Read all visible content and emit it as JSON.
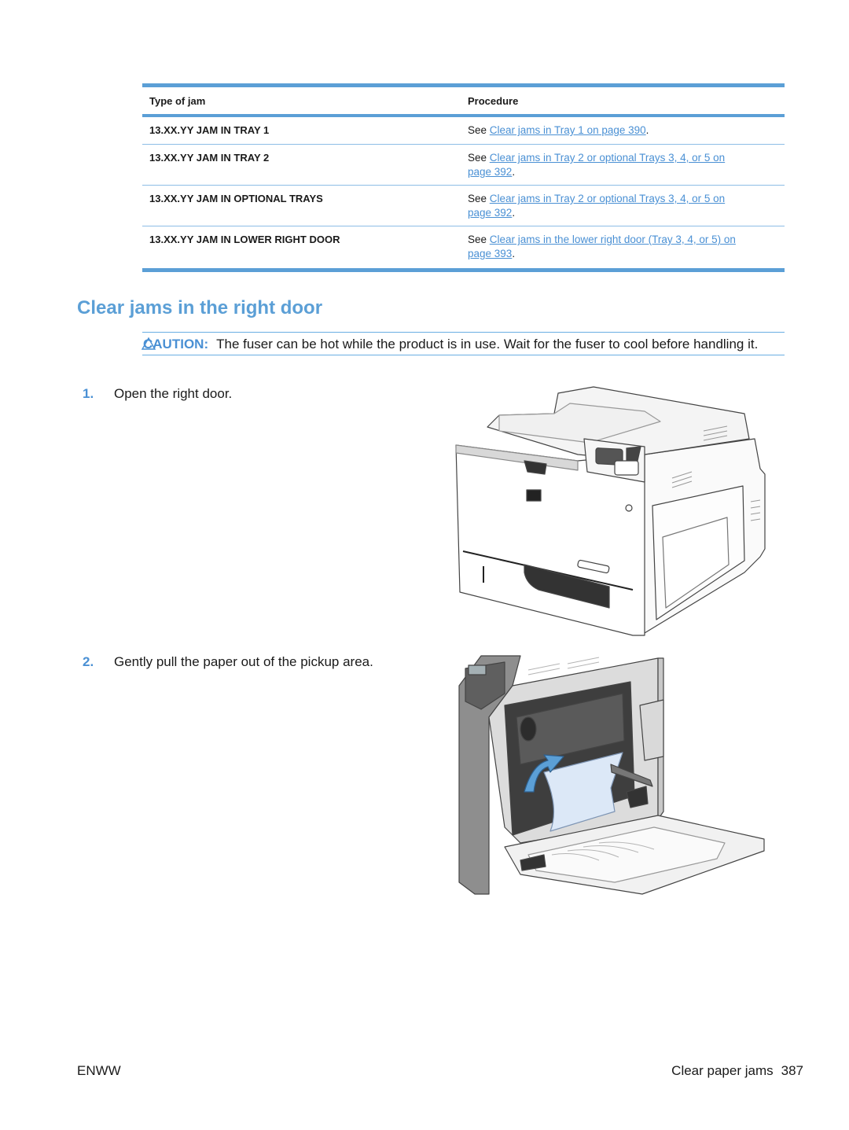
{
  "table": {
    "headers": {
      "type": "Type of jam",
      "procedure": "Procedure"
    },
    "rows": [
      {
        "type": "13.XX.YY JAM IN TRAY 1",
        "see": "See ",
        "link": "Clear jams in Tray 1 on page 390",
        "after": "."
      },
      {
        "type": "13.XX.YY JAM IN TRAY 2",
        "see": "See ",
        "link": "Clear jams in Tray 2 or optional Trays 3, 4, or 5 on page 392",
        "after": "."
      },
      {
        "type": "13.XX.YY JAM IN OPTIONAL TRAYS",
        "see": "See ",
        "link": "Clear jams in Tray 2 or optional Trays 3, 4, or 5 on page 392",
        "after": "."
      },
      {
        "type": "13.XX.YY JAM IN LOWER RIGHT DOOR",
        "see": "See ",
        "link": "Clear jams in the lower right door (Tray 3, 4, or 5) on page 393",
        "after": "."
      }
    ]
  },
  "section": {
    "title": "Clear jams in the right door",
    "caution": {
      "icon": "warning-triangle-icon",
      "label": "CAUTION:",
      "text": "The fuser can be hot while the product is in use. Wait for the fuser to cool before handling it."
    },
    "steps": [
      {
        "num": "1.",
        "text": "Open the right door.",
        "figure": "printer-closed-illustration"
      },
      {
        "num": "2.",
        "text": "Gently pull the paper out of the pickup area.",
        "figure": "printer-right-door-open-jam-illustration"
      }
    ]
  },
  "footer": {
    "left": "ENWW",
    "section": "Clear paper jams",
    "page": "387"
  },
  "colors": {
    "accent": "#5b9fd6",
    "link": "#4a90d4",
    "paper": "#dce8f7"
  }
}
